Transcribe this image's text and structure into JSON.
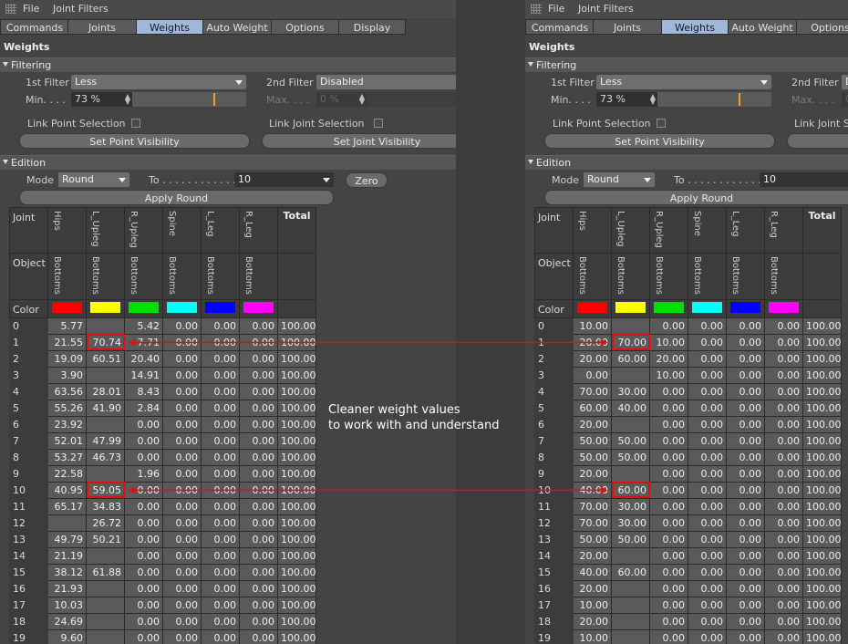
{
  "menu": {
    "file": "File",
    "joint_filters": "Joint Filters"
  },
  "tabs": [
    "Commands",
    "Joints",
    "Weights",
    "Auto Weight",
    "Options",
    "Display"
  ],
  "active_tab": "Weights",
  "section_title": "Weights",
  "filtering": {
    "header": "Filtering",
    "first_filter_label": "1st Filter",
    "first_filter_value": "Less",
    "second_filter_label": "2nd Filter",
    "second_filter_value": "Disabled",
    "min_label": "Min. . . .",
    "min_value": "73 %",
    "max_label": "Max. . . .",
    "max_value": "0 %",
    "min_fraction": 0.73,
    "link_point_label": "Link Point Selection",
    "link_joint_label": "Link Joint Selection",
    "set_point_visibility": "Set Point Visibility",
    "set_joint_visibility": "Set Joint Visibility"
  },
  "edition": {
    "header": "Edition",
    "mode_label": "Mode",
    "mode_value": "Round",
    "to_label": "To . . . . . . . . . . . .",
    "to_value": "10",
    "zero_button": "Zero",
    "apply_button": "Apply Round"
  },
  "table": {
    "row_labels": {
      "joint": "Joint",
      "object": "Object",
      "color": "Color"
    },
    "joints": [
      "Hips",
      "L_Upleg",
      "R_Upleg",
      "Spine",
      "L_Leg",
      "R_Leg"
    ],
    "total_header": "Total",
    "object": "Bottoms",
    "colors": [
      "#ff0000",
      "#ffff00",
      "#00e000",
      "#00ffff",
      "#0000ff",
      "#ff00ff"
    ],
    "row_indices": [
      "0",
      "1",
      "2",
      "3",
      "4",
      "5",
      "6",
      "7",
      "8",
      "9",
      "10",
      "11",
      "12",
      "13",
      "14",
      "15",
      "16",
      "17",
      "18",
      "19"
    ],
    "left_rows": [
      [
        "5.77",
        "",
        "5.42",
        "0.00",
        "0.00",
        "0.00",
        "100.00"
      ],
      [
        "21.55",
        "70.74",
        "7.71",
        "0.00",
        "0.00",
        "0.00",
        "100.00"
      ],
      [
        "19.09",
        "60.51",
        "20.40",
        "0.00",
        "0.00",
        "0.00",
        "100.00"
      ],
      [
        "3.90",
        "",
        "14.91",
        "0.00",
        "0.00",
        "0.00",
        "100.00"
      ],
      [
        "63.56",
        "28.01",
        "8.43",
        "0.00",
        "0.00",
        "0.00",
        "100.00"
      ],
      [
        "55.26",
        "41.90",
        "2.84",
        "0.00",
        "0.00",
        "0.00",
        "100.00"
      ],
      [
        "23.92",
        "",
        "0.00",
        "0.00",
        "0.00",
        "0.00",
        "100.00"
      ],
      [
        "52.01",
        "47.99",
        "0.00",
        "0.00",
        "0.00",
        "0.00",
        "100.00"
      ],
      [
        "53.27",
        "46.73",
        "0.00",
        "0.00",
        "0.00",
        "0.00",
        "100.00"
      ],
      [
        "22.58",
        "",
        "1.96",
        "0.00",
        "0.00",
        "0.00",
        "100.00"
      ],
      [
        "40.95",
        "59.05",
        "0.00",
        "0.00",
        "0.00",
        "0.00",
        "100.00"
      ],
      [
        "65.17",
        "34.83",
        "0.00",
        "0.00",
        "0.00",
        "0.00",
        "100.00"
      ],
      [
        "",
        "26.72",
        "0.00",
        "0.00",
        "0.00",
        "0.00",
        "100.00"
      ],
      [
        "49.79",
        "50.21",
        "0.00",
        "0.00",
        "0.00",
        "0.00",
        "100.00"
      ],
      [
        "21.19",
        "",
        "0.00",
        "0.00",
        "0.00",
        "0.00",
        "100.00"
      ],
      [
        "38.12",
        "61.88",
        "0.00",
        "0.00",
        "0.00",
        "0.00",
        "100.00"
      ],
      [
        "21.93",
        "",
        "0.00",
        "0.00",
        "0.00",
        "0.00",
        "100.00"
      ],
      [
        "10.03",
        "",
        "0.00",
        "0.00",
        "0.00",
        "0.00",
        "100.00"
      ],
      [
        "24.69",
        "",
        "0.00",
        "0.00",
        "0.00",
        "0.00",
        "100.00"
      ],
      [
        "9.60",
        "",
        "0.00",
        "0.00",
        "0.00",
        "0.00",
        "100.00"
      ]
    ],
    "right_rows": [
      [
        "10.00",
        "",
        "0.00",
        "0.00",
        "0.00",
        "0.00",
        "100.00"
      ],
      [
        "20.00",
        "70.00",
        "10.00",
        "0.00",
        "0.00",
        "0.00",
        "100.00"
      ],
      [
        "20.00",
        "60.00",
        "20.00",
        "0.00",
        "0.00",
        "0.00",
        "100.00"
      ],
      [
        "0.00",
        "",
        "10.00",
        "0.00",
        "0.00",
        "0.00",
        "100.00"
      ],
      [
        "70.00",
        "30.00",
        "0.00",
        "0.00",
        "0.00",
        "0.00",
        "100.00"
      ],
      [
        "60.00",
        "40.00",
        "0.00",
        "0.00",
        "0.00",
        "0.00",
        "100.00"
      ],
      [
        "20.00",
        "",
        "0.00",
        "0.00",
        "0.00",
        "0.00",
        "100.00"
      ],
      [
        "50.00",
        "50.00",
        "0.00",
        "0.00",
        "0.00",
        "0.00",
        "100.00"
      ],
      [
        "50.00",
        "50.00",
        "0.00",
        "0.00",
        "0.00",
        "0.00",
        "100.00"
      ],
      [
        "20.00",
        "",
        "0.00",
        "0.00",
        "0.00",
        "0.00",
        "100.00"
      ],
      [
        "40.00",
        "60.00",
        "0.00",
        "0.00",
        "0.00",
        "0.00",
        "100.00"
      ],
      [
        "70.00",
        "30.00",
        "0.00",
        "0.00",
        "0.00",
        "0.00",
        "100.00"
      ],
      [
        "70.00",
        "30.00",
        "0.00",
        "0.00",
        "0.00",
        "0.00",
        "100.00"
      ],
      [
        "50.00",
        "50.00",
        "0.00",
        "0.00",
        "0.00",
        "0.00",
        "100.00"
      ],
      [
        "20.00",
        "",
        "0.00",
        "0.00",
        "0.00",
        "0.00",
        "100.00"
      ],
      [
        "40.00",
        "60.00",
        "0.00",
        "0.00",
        "0.00",
        "0.00",
        "100.00"
      ],
      [
        "20.00",
        "",
        "0.00",
        "0.00",
        "0.00",
        "0.00",
        "100.00"
      ],
      [
        "10.00",
        "",
        "0.00",
        "0.00",
        "0.00",
        "0.00",
        "100.00"
      ],
      [
        "20.00",
        "",
        "0.00",
        "0.00",
        "0.00",
        "0.00",
        "100.00"
      ],
      [
        "10.00",
        "",
        "0.00",
        "0.00",
        "0.00",
        "0.00",
        "100.00"
      ]
    ],
    "highlight_rows": [
      1,
      10
    ]
  },
  "annotation": {
    "line1": "Cleaner weight values",
    "line2": "to work with and understand"
  },
  "accent_color": "#e01010"
}
